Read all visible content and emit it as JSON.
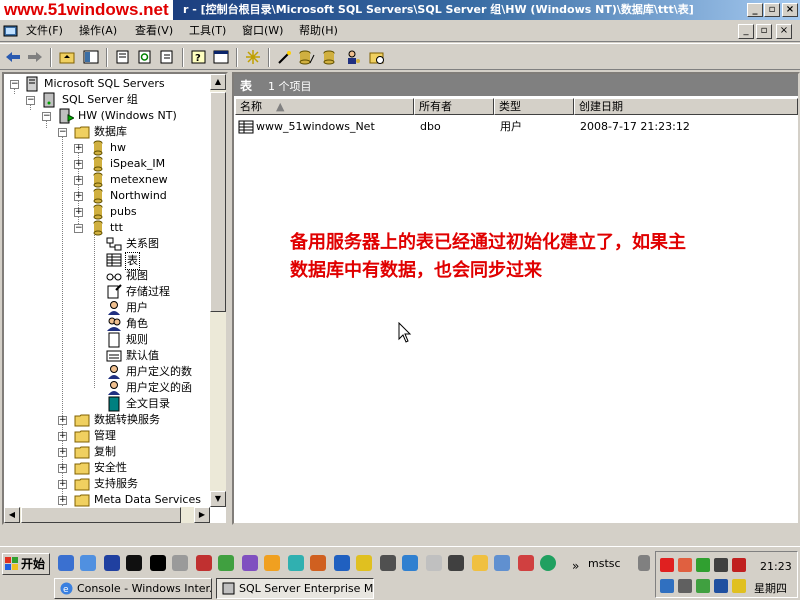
{
  "watermark": "www.51windows.net",
  "window": {
    "title": "r - [控制台根目录\\Microsoft SQL Servers\\SQL Server 组\\HW (Windows NT)\\数据库\\ttt\\表]",
    "min_glyph": "_",
    "max_glyph": "▫",
    "close_glyph": "×"
  },
  "menu": [
    "文件(F)",
    "操作(A)",
    "查看(V)",
    "工具(T)",
    "窗口(W)",
    "帮助(H)"
  ],
  "tree": {
    "root": "Microsoft SQL Servers",
    "group": "SQL Server 组",
    "server": "HW (Windows NT)",
    "databases": "数据库",
    "db_list": [
      "hw",
      "iSpeak_IM",
      "metexnew",
      "Northwind",
      "pubs"
    ],
    "current_db": "ttt",
    "objects": [
      "关系图",
      "表",
      "视图",
      "存储过程",
      "用户",
      "角色",
      "规则",
      "默认值",
      "用户定义的数",
      "用户定义的函",
      "全文目录"
    ],
    "server_folders": [
      "数据转换服务",
      "管理",
      "复制",
      "安全性",
      "支持服务",
      "Meta Data Services"
    ]
  },
  "right_pane": {
    "title": "表",
    "count": "1 个项目",
    "columns": [
      "名称",
      "所有者",
      "类型",
      "创建日期"
    ],
    "rows": [
      {
        "name": "www_51windows_Net",
        "owner": "dbo",
        "type": "用户",
        "created": "2008-7-17 21:23:12"
      }
    ]
  },
  "annotation": {
    "line1": "备用服务器上的表已经通过初始化建立了，如果主",
    "line2": "数据库中有数据，也会同步过来"
  },
  "taskbar": {
    "start": "开始",
    "tasks": [
      "Console - Windows Inter...",
      "SQL Server Enterprise M..."
    ],
    "mstsc": "mstsc",
    "time": "21:23",
    "day": "星期四"
  },
  "colors": {
    "annotation": "#e00000",
    "titlebar": "#0a246a"
  }
}
